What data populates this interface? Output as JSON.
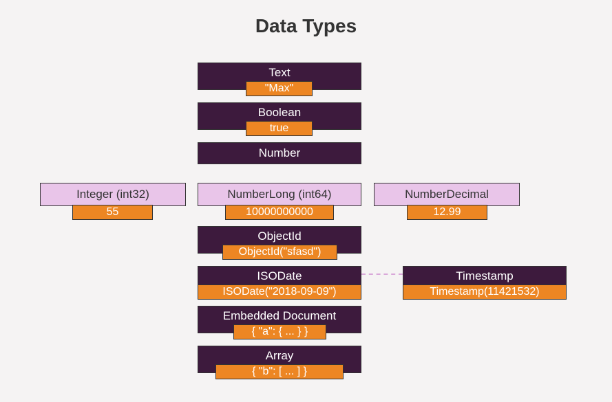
{
  "title": "Data Types",
  "types": {
    "text": {
      "label": "Text",
      "example": "\"Max\""
    },
    "boolean": {
      "label": "Boolean",
      "example": "true"
    },
    "number": {
      "label": "Number"
    },
    "int32": {
      "label": "Integer (int32)",
      "example": "55"
    },
    "int64": {
      "label": "NumberLong (int64)",
      "example": "10000000000"
    },
    "decimal": {
      "label": "NumberDecimal",
      "example": "12.99"
    },
    "objectid": {
      "label": "ObjectId",
      "example": "ObjectId(\"sfasd\")"
    },
    "isodate": {
      "label": "ISODate",
      "example": "ISODate(\"2018-09-09\")"
    },
    "timestamp": {
      "label": "Timestamp",
      "example": "Timestamp(11421532)"
    },
    "embedded": {
      "label": "Embedded Document",
      "example": "{ \"a\": { ... } }"
    },
    "array": {
      "label": "Array",
      "example": "{ \"b\": [ ... ] }"
    }
  }
}
